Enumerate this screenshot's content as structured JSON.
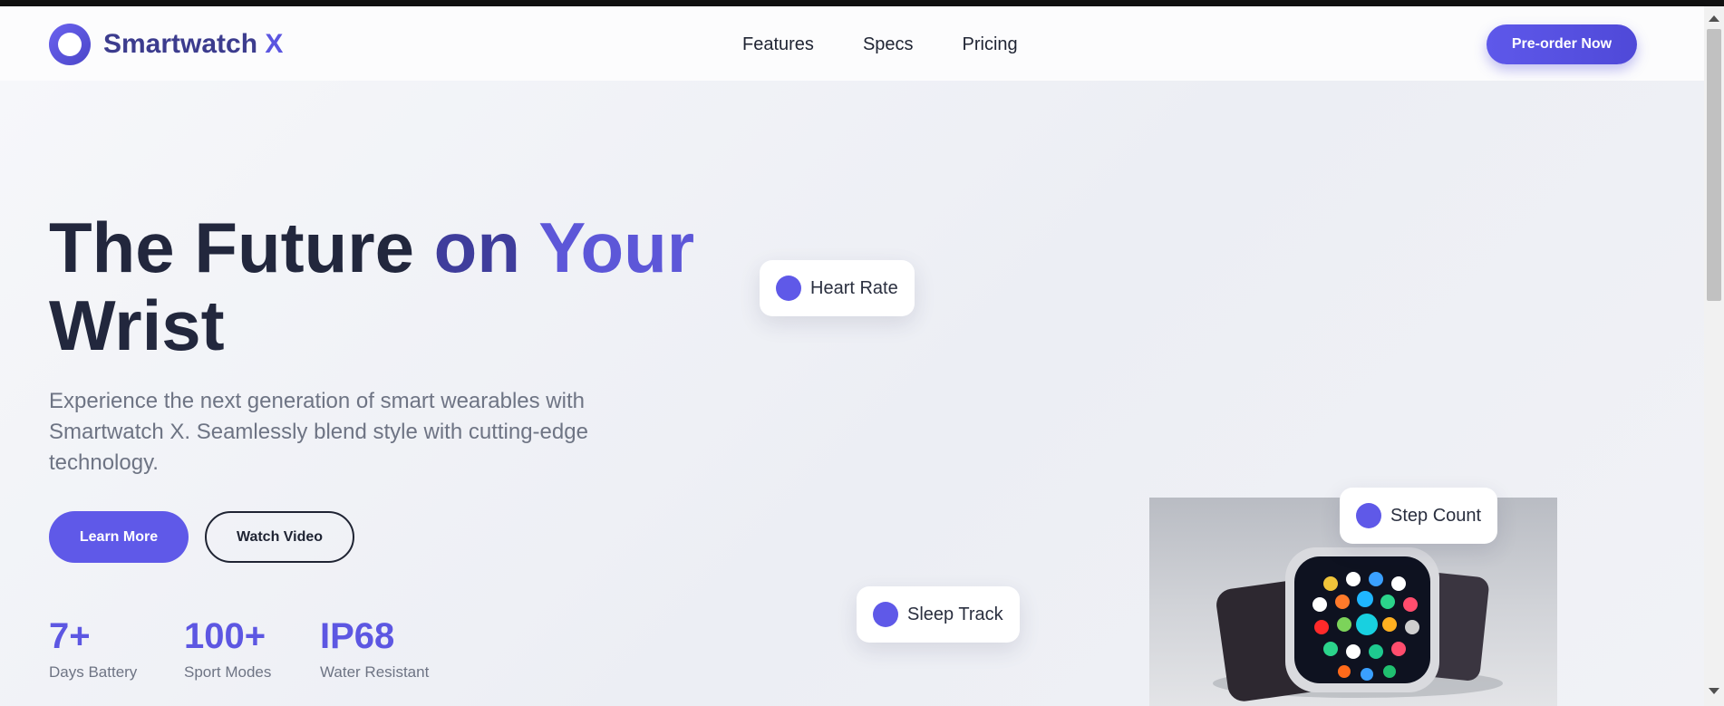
{
  "brand": {
    "name": "Smartwatch",
    "accent": "X"
  },
  "nav": {
    "items": [
      {
        "label": "Features"
      },
      {
        "label": "Specs"
      },
      {
        "label": "Pricing"
      }
    ],
    "cta_label": "Pre-order Now"
  },
  "hero": {
    "title_part1": "The Future",
    "title_part2": "on",
    "title_part3": "Your",
    "title_part4": "Wrist",
    "subtitle": "Experience the next generation of smart wearables with Smartwatch X. Seamlessly blend style with cutting-edge technology.",
    "primary_button": "Learn More",
    "secondary_button": "Watch Video",
    "stats": [
      {
        "value": "7+",
        "label": "Days Battery"
      },
      {
        "value": "100+",
        "label": "Sport Modes"
      },
      {
        "value": "IP68",
        "label": "Water Resistant"
      }
    ]
  },
  "features": {
    "chips": [
      {
        "label": "Heart Rate"
      },
      {
        "label": "Step Count"
      },
      {
        "label": "Sleep Track"
      }
    ]
  },
  "colors": {
    "accent": "#5f59e8",
    "dark_text": "#22273d",
    "muted_text": "#6e7484"
  }
}
